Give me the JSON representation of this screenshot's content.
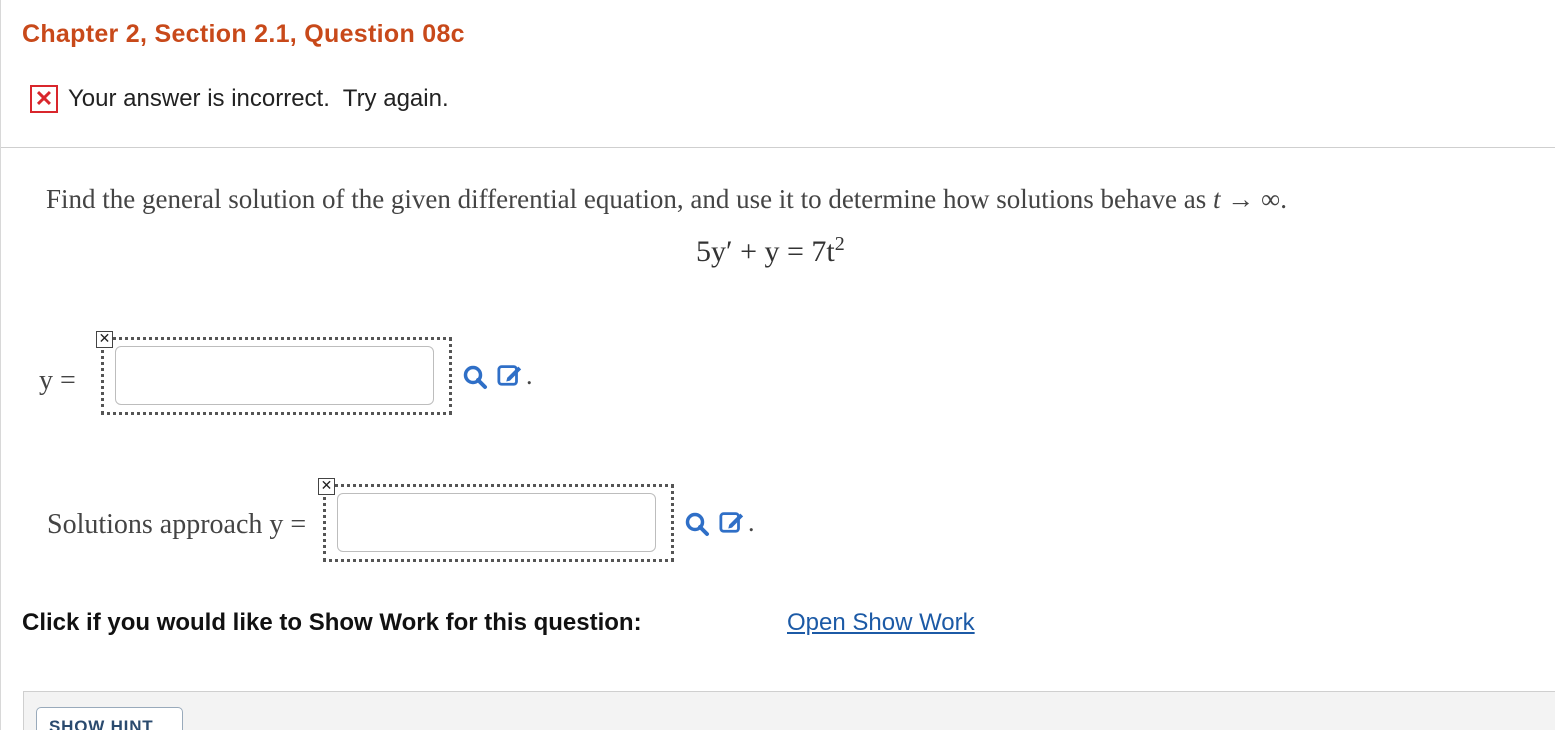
{
  "header": {
    "title": "Chapter 2, Section 2.1, Question 08c"
  },
  "feedback": {
    "icon": "x-mark-icon",
    "text": "Your answer is incorrect.  Try again.",
    "color": "#d9262c"
  },
  "question": {
    "prompt": "Find the general solution of the given differential equation, and use it to determine how solutions behave as",
    "limit_var": "t",
    "limit_arrow": "→",
    "limit_to": "∞",
    "period": ".",
    "equation_left": "5y′ + y = 7t",
    "equation_exp": "2"
  },
  "answers": {
    "general": {
      "label": "y =",
      "value": "",
      "status_icon": "x-mark-icon"
    },
    "limit": {
      "label": "Solutions approach y =",
      "value": "",
      "status_icon": "x-mark-icon"
    },
    "trailing_dot": "."
  },
  "show_work": {
    "label": "Click if you would like to Show Work for this question:",
    "link": "Open Show Work"
  },
  "hint": {
    "button": "SHOW HINT"
  },
  "colors": {
    "title": "#c8491a",
    "link": "#1c5aa6",
    "icon_blue": "#2f6fc7"
  }
}
